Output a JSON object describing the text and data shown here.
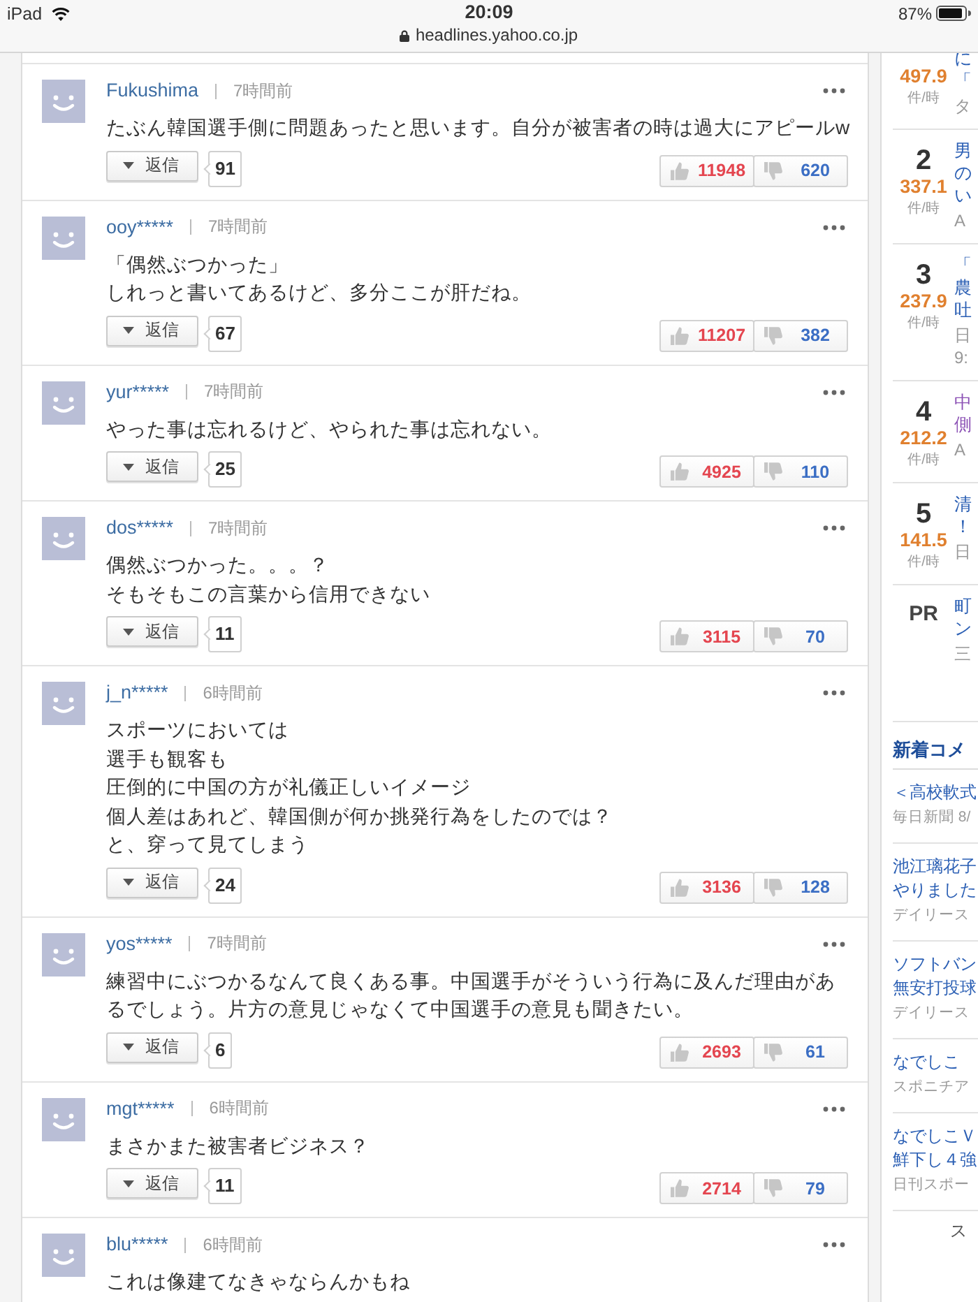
{
  "status_bar": {
    "device": "iPad",
    "time": "20:09",
    "url": "headlines.yahoo.co.jp",
    "battery": "87%"
  },
  "comments": [
    {
      "user": "Fukushima",
      "time": "7時間前",
      "lines": [
        "たぶん韓国選手側に問題あったと思います。自分が被害者の時は過大にアピールw"
      ],
      "reply_label": "返信",
      "replies": "91",
      "likes": "11948",
      "dislikes": "620"
    },
    {
      "user": "ooy*****",
      "time": "7時間前",
      "lines": [
        "「偶然ぶつかった」",
        "しれっと書いてあるけど、多分ここが肝だね。"
      ],
      "reply_label": "返信",
      "replies": "67",
      "likes": "11207",
      "dislikes": "382"
    },
    {
      "user": "yur*****",
      "time": "7時間前",
      "lines": [
        "やった事は忘れるけど、やられた事は忘れない。"
      ],
      "reply_label": "返信",
      "replies": "25",
      "likes": "4925",
      "dislikes": "110"
    },
    {
      "user": "dos*****",
      "time": "7時間前",
      "lines": [
        "偶然ぶつかった。。。？",
        "そもそもこの言葉から信用できない"
      ],
      "reply_label": "返信",
      "replies": "11",
      "likes": "3115",
      "dislikes": "70"
    },
    {
      "user": "j_n*****",
      "time": "6時間前",
      "lines": [
        "スポーツにおいては",
        "選手も観客も",
        "圧倒的に中国の方が礼儀正しいイメージ",
        "個人差はあれど、韓国側が何か挑発行為をしたのでは？",
        "と、穿って見てしまう"
      ],
      "reply_label": "返信",
      "replies": "24",
      "likes": "3136",
      "dislikes": "128"
    },
    {
      "user": "yos*****",
      "time": "7時間前",
      "lines": [
        "練習中にぶつかるなんて良くある事。中国選手がそういう行為に及んだ理由があるでしょう。片方の意見じゃなくて中国選手の意見も聞きたい。"
      ],
      "reply_label": "返信",
      "replies": "6",
      "likes": "2693",
      "dislikes": "61"
    },
    {
      "user": "mgt*****",
      "time": "6時間前",
      "lines": [
        "まさかまた被害者ビジネス？"
      ],
      "reply_label": "返信",
      "replies": "11",
      "likes": "2714",
      "dislikes": "79"
    },
    {
      "user": "blu*****",
      "time": "6時間前",
      "lines": [
        "これは像建てなきゃならんかもね"
      ]
    }
  ],
  "sidebar": {
    "ranking": [
      {
        "kind": "ranked",
        "score": "497.9",
        "unit": "件/時",
        "title": "に「",
        "source": "タ",
        "visited": false
      },
      {
        "kind": "ranked",
        "rank": "2",
        "score": "337.1",
        "unit": "件/時",
        "title": "男のい",
        "source": "A",
        "visited": false
      },
      {
        "kind": "ranked",
        "rank": "3",
        "score": "237.9",
        "unit": "件/時",
        "title": "「農吐",
        "source": "日9:",
        "visited": false
      },
      {
        "kind": "ranked",
        "rank": "4",
        "score": "212.2",
        "unit": "件/時",
        "title": "中側",
        "source": "A",
        "visited": true
      },
      {
        "kind": "ranked",
        "rank": "5",
        "score": "141.5",
        "unit": "件/時",
        "title": "清！",
        "source": "日",
        "visited": false
      },
      {
        "kind": "pr",
        "label": "PR",
        "title": "町ン",
        "source": "三",
        "visited": false
      }
    ],
    "new_comments": {
      "title": "新着コメ",
      "items": [
        {
          "title": "＜高校軟式",
          "source": "毎日新聞 8/"
        },
        {
          "title": "池江璃花子やりました",
          "source": "デイリース"
        },
        {
          "title": "ソフトバン無安打投球",
          "source": "デイリース"
        },
        {
          "title": "なでしこ",
          "source": "スポニチア"
        },
        {
          "title": "なでしこＶ鮮下し４強",
          "source": "日刊スポー"
        }
      ]
    },
    "more_link": "ス"
  }
}
